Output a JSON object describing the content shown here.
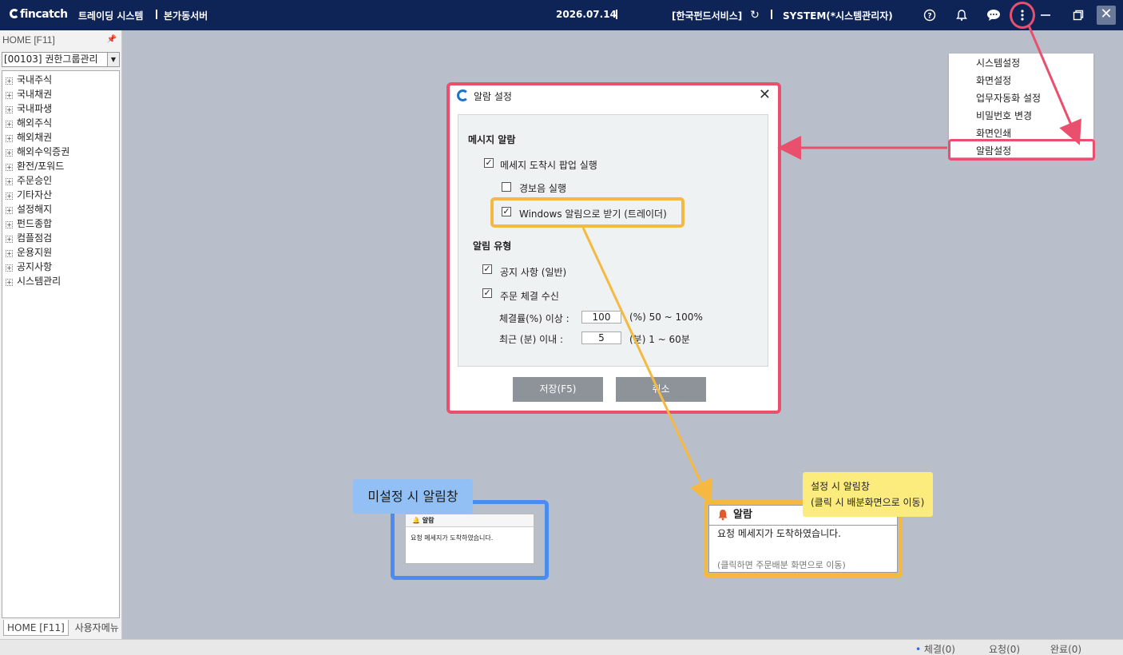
{
  "titlebar": {
    "logo": "fincatch",
    "app_name": "트레이딩 시스템",
    "server": "본가동서버",
    "date": "2026.07.14",
    "company": "[한국펀드서비스]",
    "user": "SYSTEM(*시스템관리자)"
  },
  "left_panel": {
    "title": "HOME [F11]",
    "combo_value": "[00103] 권한그룹관리",
    "tree_items": [
      "국내주식",
      "국내채권",
      "국내파생",
      "해외주식",
      "해외채권",
      "해외수익증권",
      "환전/포워드",
      "주문승인",
      "기타자산",
      "설정해지",
      "펀드종합",
      "컴플점검",
      "운용지원",
      "공지사항",
      "시스템관리"
    ],
    "tabs": [
      "HOME [F11]",
      "사용자메뉴"
    ]
  },
  "menu": {
    "items": [
      "시스템설정",
      "화면설정",
      "업무자동화 설정",
      "비밀번호 변경",
      "화면인쇄",
      "알람설정"
    ]
  },
  "dialog": {
    "title": "알람 설정",
    "section_message": "메시지 알람",
    "opt_popup": "메세지 도착시 팝업 실행",
    "opt_sound": "경보음 실행",
    "opt_windows": "Windows 알림으로 받기 (트레이더)",
    "section_type": "알림 유형",
    "opt_notice": "공지 사항 (일반)",
    "opt_order": "주문 체결 수신",
    "fill_rate_label": "체결률(%) 이상 :",
    "fill_rate_value": "100",
    "fill_rate_range": "(%) 50 ~ 100%",
    "recent_label": "최근 (분) 이내 :",
    "recent_value": "5",
    "recent_range": "(분)  1 ~ 60분",
    "save": "저장(F5)",
    "cancel": "취소"
  },
  "preview_unset": {
    "label": "미설정 시 알림창",
    "popup_title": "알람",
    "popup_msg": "요청 메세지가 도착하였습니다."
  },
  "preview_set": {
    "label_line1": "설정 시 알림창",
    "label_line2": "(클릭 시 배분화면으로 이동)",
    "popup_title": "알람",
    "popup_msg": "요청 메세지가 도착하였습니다.",
    "popup_hint": "(클릭하면 주문배분 화면으로 이동)"
  },
  "statusbar": {
    "fill": "체결(0)",
    "request": "요청(0)",
    "done": "완료(0)"
  },
  "colors": {
    "titlebar": "#0f2456",
    "highlight_red": "#e8506d",
    "highlight_orange": "#f5b941",
    "highlight_blue": "#4b8cf0"
  }
}
